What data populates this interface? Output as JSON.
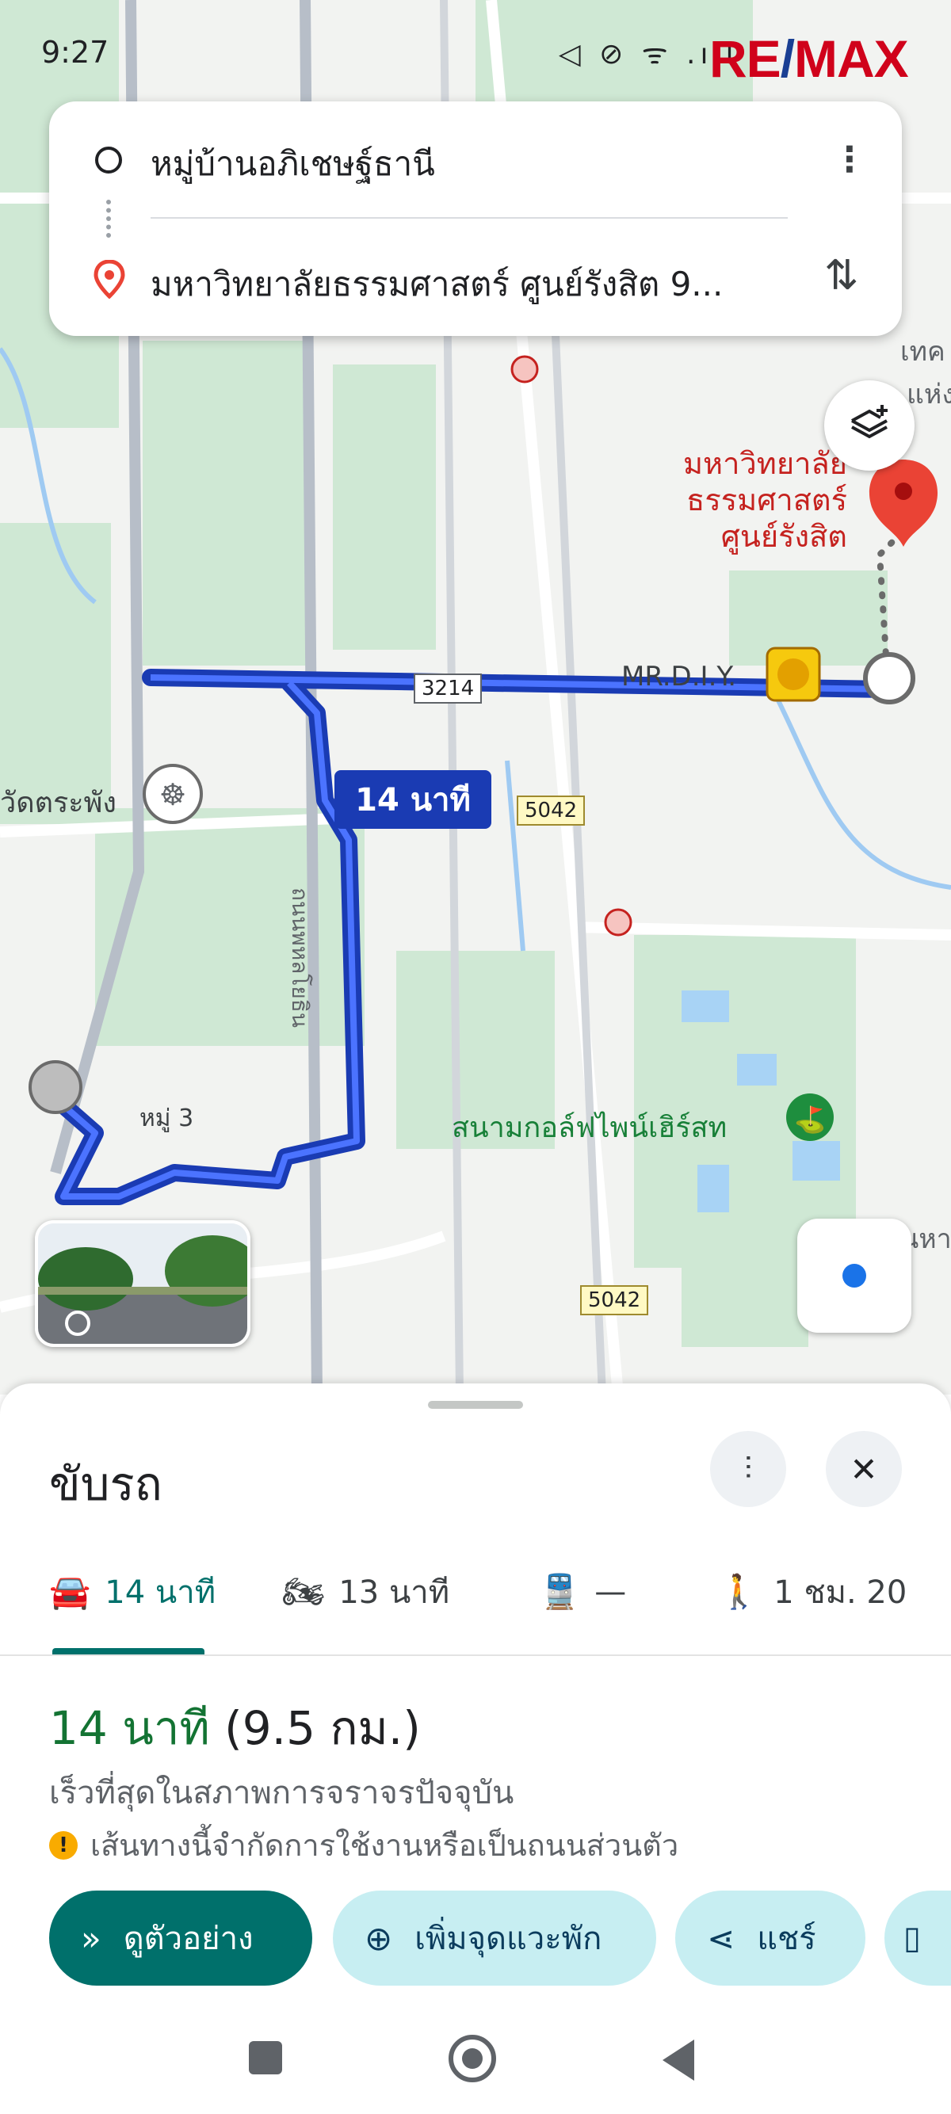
{
  "status_bar": {
    "time": "9:27",
    "icons": "◁ ⊘ ᯤ .ıll"
  },
  "watermark": {
    "part1": "RE",
    "part2": "/",
    "part3": "MAX"
  },
  "directions": {
    "origin": "หมู่บ้านอภิเชษฐ์ธานี",
    "destination": "มหาวิทยาลัยธรรมศาสตร์ ศูนย์รังสิต 9..."
  },
  "map": {
    "destination_label_lines": [
      "มหาวิทยาลัย",
      "ธรรมศาสตร์",
      "ศูนย์รังสิต"
    ],
    "store_label": "MR.D.I.Y.",
    "temple_label": "วัดตระพัง",
    "village_label": "หมู่ 3",
    "golf_label": "สนามกอล์ฟไพน์เฮิร์สท",
    "route_time_badge": "14 นาที",
    "road_shields": [
      "3214",
      "5042",
      "5042"
    ],
    "edge_labels": [
      "เทค",
      "แห่ง",
      "นหา"
    ],
    "road_name": "ถนนพหลโยธิน"
  },
  "sheet": {
    "title": "ขับรถ",
    "tabs": [
      {
        "icon": "car-icon",
        "label": "14 นาที"
      },
      {
        "icon": "motorcycle-icon",
        "label": "13 นาที"
      },
      {
        "icon": "train-icon",
        "label": "—"
      },
      {
        "icon": "walk-icon",
        "label": "1 ชม. 20"
      }
    ],
    "route_time": "14 นาที",
    "route_distance": "(9.5 กม.)",
    "route_description": "เร็วที่สุดในสภาพการจราจรปัจจุบัน",
    "warning": "เส้นทางนี้จำกัดการใช้งานหรือเป็นถนนส่วนตัว",
    "actions": {
      "preview": "ดูตัวอย่าง",
      "add_stop": "เพิ่มจุดแวะพัก",
      "share": "แชร์"
    }
  },
  "colors": {
    "route": "#1a3bb3",
    "accent": "#00706b",
    "pin": "#ea4335"
  }
}
